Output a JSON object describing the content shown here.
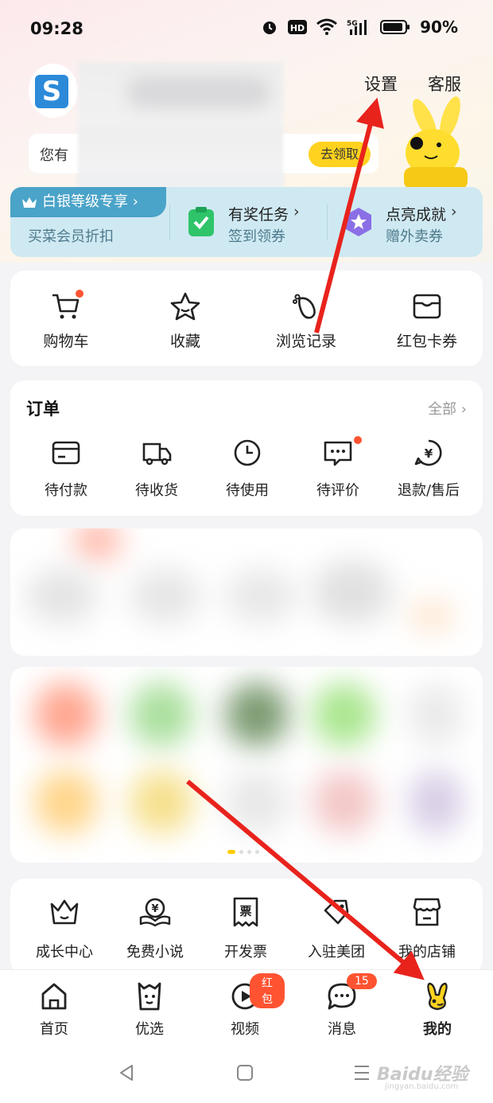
{
  "status_bar": {
    "time": "09:28",
    "battery": "90%",
    "hd_label": "HD",
    "network": "5G"
  },
  "header": {
    "settings_label": "设置",
    "service_label": "客服",
    "coupon_text": "您有",
    "coupon_button": "去领取"
  },
  "membership": {
    "tier_label": "白银等级专享",
    "tier_sub": "买菜会员折扣",
    "task_title": "有奖任务",
    "task_sub": "签到领券",
    "achieve_title": "点亮成就",
    "achieve_sub": "赠外卖券"
  },
  "quick_actions": [
    {
      "label": "购物车",
      "icon": "cart-icon"
    },
    {
      "label": "收藏",
      "icon": "star-icon"
    },
    {
      "label": "浏览记录",
      "icon": "footprint-icon"
    },
    {
      "label": "红包卡券",
      "icon": "wallet-icon"
    }
  ],
  "orders": {
    "title": "订单",
    "all_label": "全部",
    "items": [
      {
        "label": "待付款",
        "icon": "card-icon"
      },
      {
        "label": "待收货",
        "icon": "truck-icon"
      },
      {
        "label": "待使用",
        "icon": "clock-icon"
      },
      {
        "label": "待评价",
        "icon": "comment-icon"
      },
      {
        "label": "退款/售后",
        "icon": "refund-icon"
      }
    ]
  },
  "tools": [
    {
      "label": "成长中心",
      "icon": "crown-icon"
    },
    {
      "label": "免费小说",
      "icon": "book-icon"
    },
    {
      "label": "开发票",
      "icon": "invoice-icon"
    },
    {
      "label": "入驻美团",
      "icon": "tag-icon"
    },
    {
      "label": "我的店铺",
      "icon": "shop-icon"
    }
  ],
  "tabs": [
    {
      "label": "首页",
      "icon": "home-icon"
    },
    {
      "label": "优选",
      "icon": "bag-icon"
    },
    {
      "label": "视频",
      "icon": "play-icon",
      "badge": "红包"
    },
    {
      "label": "消息",
      "icon": "chat-icon",
      "badge": "15"
    },
    {
      "label": "我的",
      "icon": "kangaroo-icon"
    }
  ],
  "watermark": {
    "main": "Baidu经验",
    "sub": "jingyan.baidu.com"
  },
  "colors": {
    "accent_yellow": "#ffd21f",
    "badge_red": "#ff5331",
    "member_blue": "#4aa3c8",
    "arrow_red": "#e8231c"
  }
}
